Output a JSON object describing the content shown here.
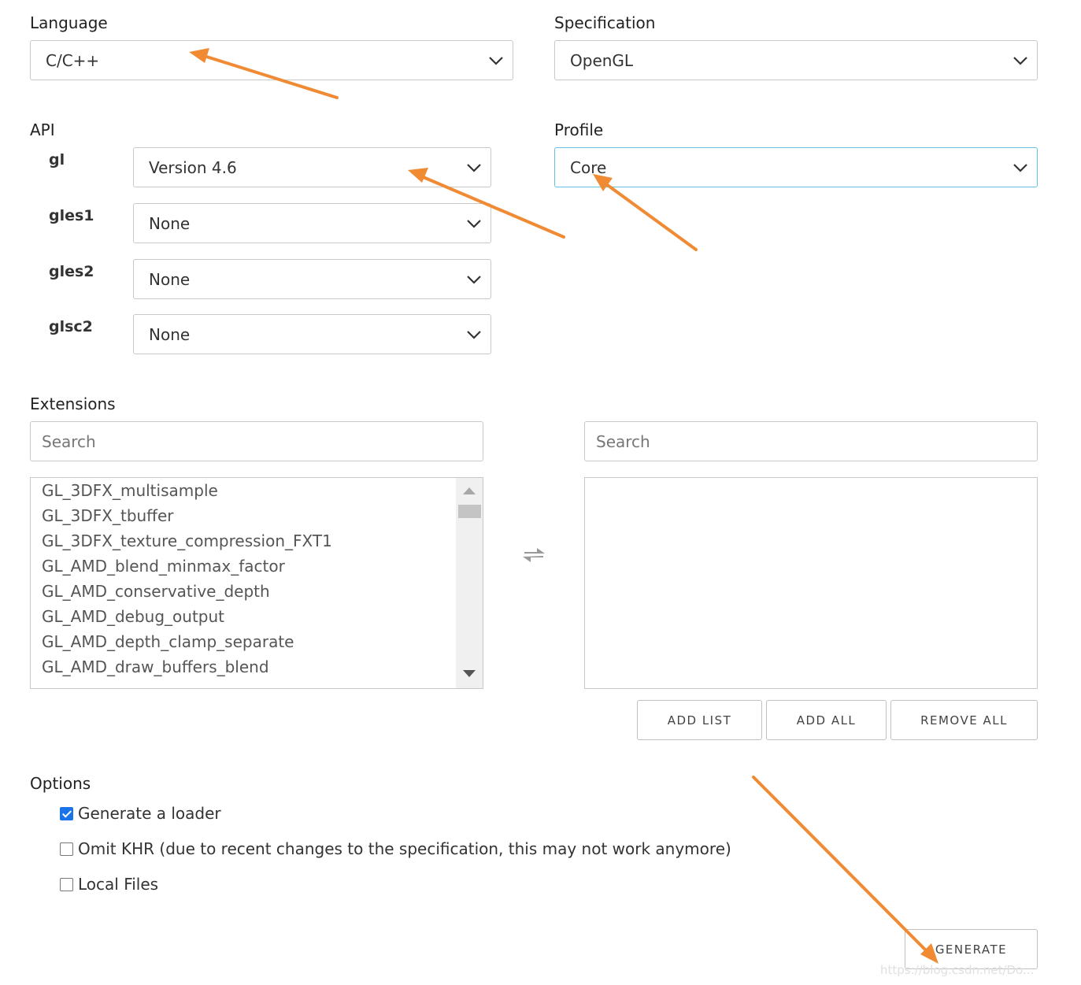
{
  "language": {
    "label": "Language",
    "value": "C/C++"
  },
  "specification": {
    "label": "Specification",
    "value": "OpenGL"
  },
  "api": {
    "label": "API",
    "rows": [
      {
        "name": "gl",
        "value": "Version 4.6"
      },
      {
        "name": "gles1",
        "value": "None"
      },
      {
        "name": "gles2",
        "value": "None"
      },
      {
        "name": "glsc2",
        "value": "None"
      }
    ]
  },
  "profile": {
    "label": "Profile",
    "value": "Core"
  },
  "extensions": {
    "label": "Extensions",
    "left_search_placeholder": "Search",
    "right_search_placeholder": "Search",
    "available": [
      "GL_3DFX_multisample",
      "GL_3DFX_tbuffer",
      "GL_3DFX_texture_compression_FXT1",
      "GL_AMD_blend_minmax_factor",
      "GL_AMD_conservative_depth",
      "GL_AMD_debug_output",
      "GL_AMD_depth_clamp_separate",
      "GL_AMD_draw_buffers_blend"
    ],
    "buttons": {
      "add_list": "ADD LIST",
      "add_all": "ADD ALL",
      "remove_all": "REMOVE ALL"
    }
  },
  "options": {
    "label": "Options",
    "items": [
      {
        "label": "Generate a loader",
        "checked": true
      },
      {
        "label": "Omit KHR (due to recent changes to the specification, this may not work anymore)",
        "checked": false
      },
      {
        "label": "Local Files",
        "checked": false
      }
    ]
  },
  "generate_label": "GENERATE",
  "watermark": "https://blog.csdn.net/Do...",
  "colors": {
    "annotation_arrow": "#f08a33",
    "focus_border": "#63c3e0",
    "checkbox_checked": "#1a73e8"
  },
  "icons": [
    "chevron-down-icon",
    "swap-icon",
    "scroll-up-icon",
    "scroll-down-icon",
    "check-icon"
  ]
}
